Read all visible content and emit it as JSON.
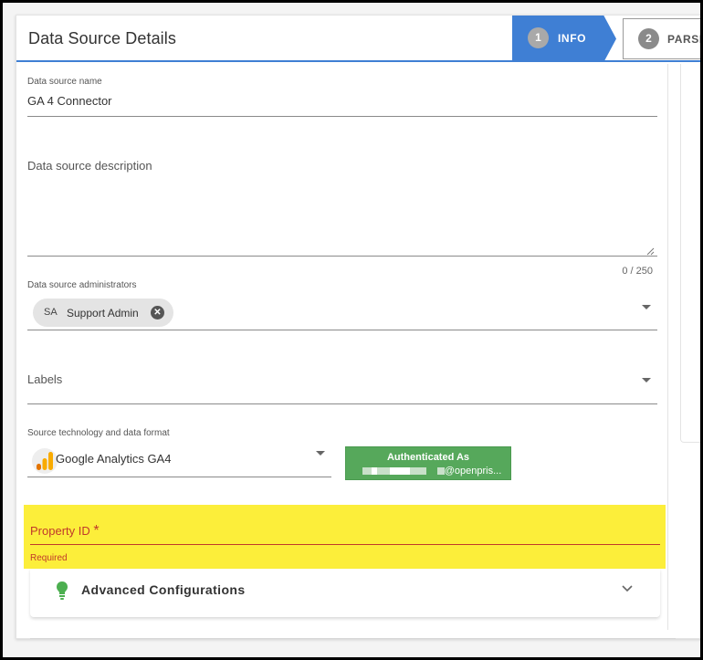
{
  "header": {
    "title": "Data Source Details",
    "steps": [
      {
        "number": "1",
        "label": "INFO",
        "active": true
      },
      {
        "number": "2",
        "label": "PARSE",
        "active": false
      }
    ]
  },
  "form": {
    "name": {
      "label": "Data source name",
      "value": "GA 4 Connector"
    },
    "description": {
      "placeholder": "Data source description",
      "counter": "0 / 250"
    },
    "administrators": {
      "label": "Data source administrators",
      "chips": [
        {
          "initials": "SA",
          "name": "Support Admin"
        }
      ]
    },
    "labels": {
      "placeholder": "Labels"
    },
    "source": {
      "label": "Source technology and data format",
      "value": "Google Analytics GA4",
      "icon": "google-analytics-icon"
    },
    "auth_button": {
      "title": "Authenticated As",
      "user_suffix": "@openpris..."
    },
    "property_id": {
      "label": "Property ID",
      "asterisk": "*",
      "error": "Required"
    },
    "advanced": {
      "label": "Advanced Configurations",
      "icon": "lightbulb-icon"
    }
  },
  "colors": {
    "accent": "#3f7fd4",
    "auth_green": "#56a85b",
    "highlight": "#fcee3a",
    "error": "#c0392b"
  }
}
